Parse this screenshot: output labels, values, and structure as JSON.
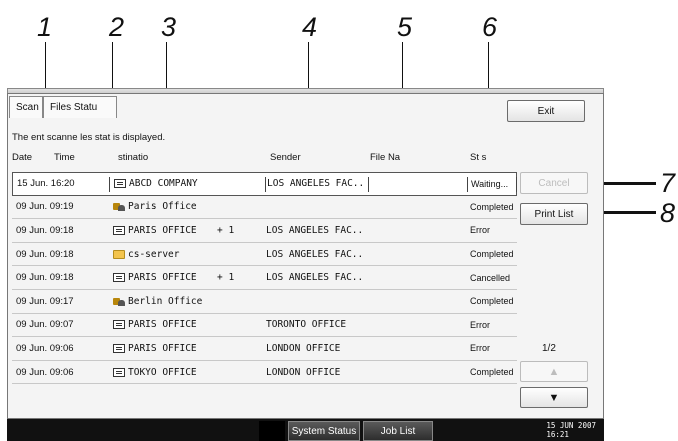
{
  "callouts": [
    "1",
    "2",
    "3",
    "4",
    "5",
    "6",
    "7",
    "8"
  ],
  "header": {
    "tab1": "Scan",
    "tab2": "Files Statu",
    "exit_label": "Exit"
  },
  "info_text": "The   ent scanne   les stat   is displayed.",
  "columns": {
    "date": "Date",
    "time": "Time",
    "destination": "stinatio",
    "sender": "Sender",
    "file_name": "File Na",
    "status": "St   s"
  },
  "rows": [
    {
      "date": "15 Jun. 16:20",
      "icon": "fax-icon",
      "destination": "ABCD COMPANY",
      "plus": "",
      "sender": "LOS ANGELES FAC..",
      "status": "Waiting..."
    },
    {
      "date": "09 Jun. 09:19",
      "icon": "user-icon",
      "destination": "Paris Office",
      "plus": "",
      "sender": "",
      "status": "Completed"
    },
    {
      "date": "09 Jun. 09:18",
      "icon": "fax-icon",
      "destination": "PARIS OFFICE",
      "plus": "+ 1",
      "sender": "LOS ANGELES FAC..",
      "status": "Error"
    },
    {
      "date": "09 Jun. 09:18",
      "icon": "folder-icon",
      "destination": "cs-server",
      "plus": "",
      "sender": "LOS ANGELES FAC..",
      "status": "Completed"
    },
    {
      "date": "09 Jun. 09:18",
      "icon": "fax-icon",
      "destination": "PARIS OFFICE",
      "plus": "+ 1",
      "sender": "LOS ANGELES FAC..",
      "status": "Cancelled"
    },
    {
      "date": "09 Jun. 09:17",
      "icon": "user-icon",
      "destination": "Berlin Office",
      "plus": "",
      "sender": "",
      "status": "Completed"
    },
    {
      "date": "09 Jun. 09:07",
      "icon": "fax-icon",
      "destination": "PARIS OFFICE",
      "plus": "",
      "sender": "TORONTO OFFICE",
      "status": "Error"
    },
    {
      "date": "09 Jun. 09:06",
      "icon": "fax-icon",
      "destination": "PARIS OFFICE",
      "plus": "",
      "sender": "LONDON OFFICE",
      "status": "Error"
    },
    {
      "date": "09 Jun. 09:06",
      "icon": "fax-icon",
      "destination": "TOKYO OFFICE",
      "plus": "",
      "sender": "LONDON OFFICE",
      "status": "Completed"
    }
  ],
  "side": {
    "cancel_label": "Cancel",
    "print_list_label": "Print List",
    "page_indicator": "1/2"
  },
  "bottom": {
    "system_status_label": "System Status",
    "job_list_label": "Job List",
    "date_line": "15 JUN  2007",
    "time_line": "16:21"
  }
}
